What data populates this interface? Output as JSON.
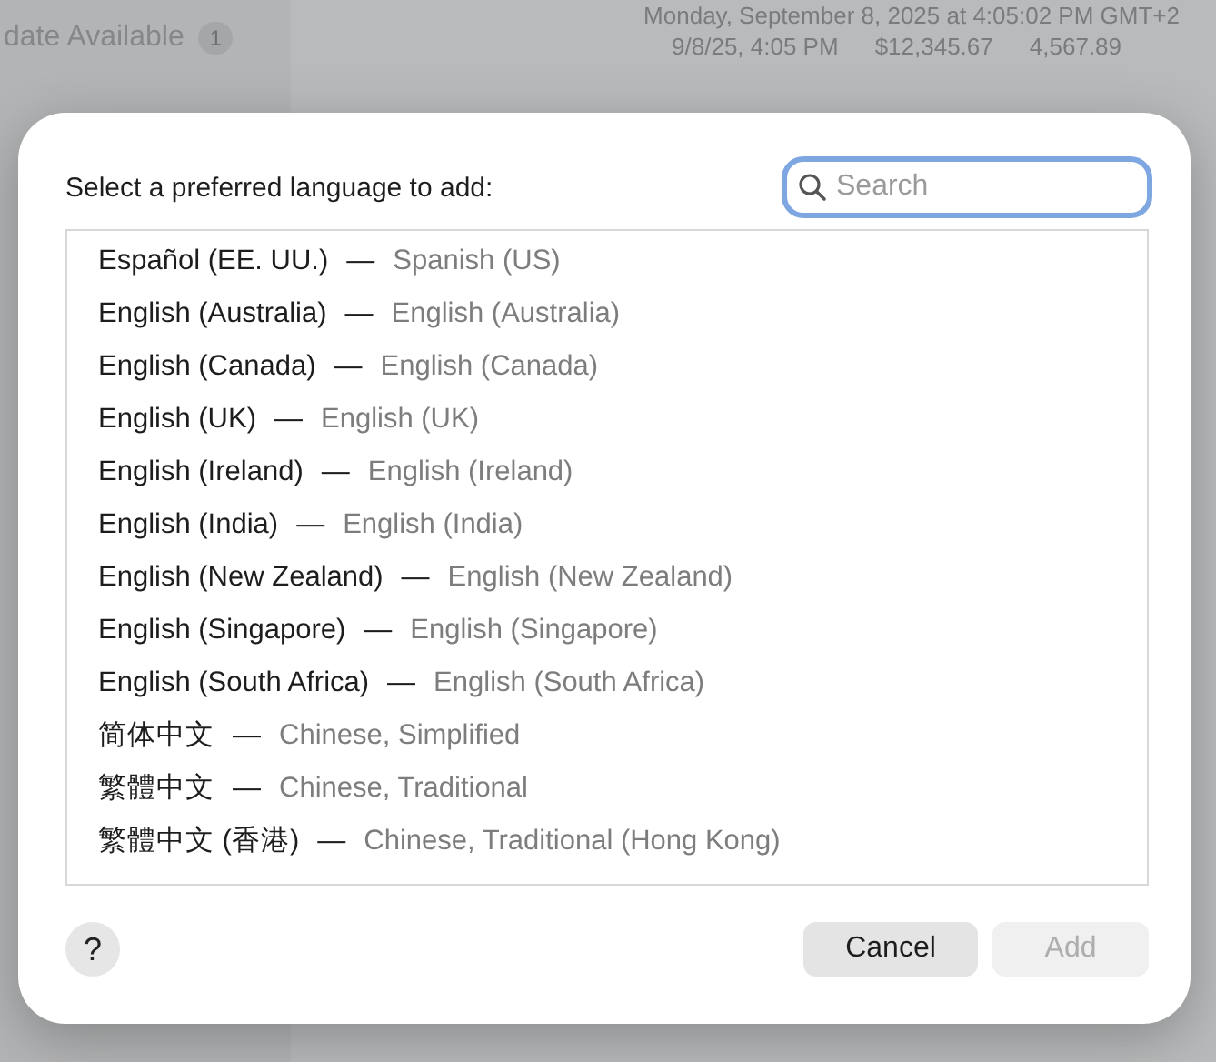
{
  "background": {
    "sidebar": {
      "update_label": "date Available",
      "update_badge": "1"
    },
    "header": {
      "date_long": "Monday, September 8, 2025 at 4:05:02 PM GMT+2",
      "date_short": "9/8/25, 4:05 PM",
      "currency": "$12,345.67",
      "number": "4,567.89"
    }
  },
  "dialog": {
    "prompt": "Select a preferred language to add:",
    "search": {
      "placeholder": "Search"
    },
    "languages": [
      {
        "native": "Español (EE. UU.)",
        "english": "Spanish (US)"
      },
      {
        "native": "English (Australia)",
        "english": "English (Australia)"
      },
      {
        "native": "English (Canada)",
        "english": "English (Canada)"
      },
      {
        "native": "English (UK)",
        "english": "English (UK)"
      },
      {
        "native": "English (Ireland)",
        "english": "English (Ireland)"
      },
      {
        "native": "English (India)",
        "english": "English (India)"
      },
      {
        "native": "English (New Zealand)",
        "english": "English (New Zealand)"
      },
      {
        "native": "English (Singapore)",
        "english": "English (Singapore)"
      },
      {
        "native": "English (South Africa)",
        "english": "English (South Africa)"
      },
      {
        "native": "简体中文",
        "english": "Chinese, Simplified"
      },
      {
        "native": "繁體中文",
        "english": "Chinese, Traditional"
      },
      {
        "native": "繁體中文 (香港)",
        "english": "Chinese, Traditional (Hong Kong)"
      }
    ],
    "separator": "—",
    "help": "?",
    "buttons": [
      {
        "label": "Cancel",
        "disabled": false
      },
      {
        "label": "Add",
        "disabled": true
      }
    ]
  }
}
